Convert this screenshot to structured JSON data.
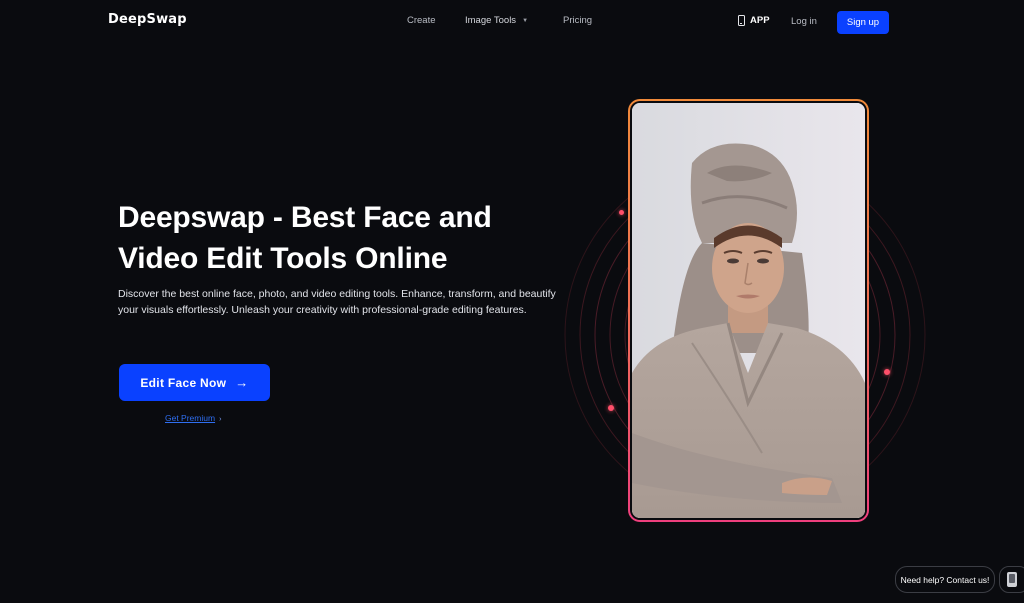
{
  "header": {
    "logo": "DeepSwap",
    "nav": {
      "create": "Create",
      "image_tools": "Image Tools",
      "pricing": "Pricing"
    },
    "app_label": "APP",
    "login_label": "Log in",
    "signup_label": "Sign up"
  },
  "hero": {
    "title": "Deepswap - Best Face and Video Edit Tools Online",
    "description": "Discover the best online face, photo, and video editing tools. Enhance, transform, and beautify your visuals effortlessly. Unleash your creativity with professional-grade editing features.",
    "cta_label": "Edit Face Now",
    "cta_arrow": "→",
    "premium_label": "Get Premium",
    "premium_chevron": "›"
  },
  "visual": {
    "image_alt": "Woman with towel wrapped on head wearing a bathrobe",
    "frame_gradient": [
      "#f18a3a",
      "#ef3f7d"
    ],
    "dot_color": "#ff4f6a"
  },
  "help": {
    "label": "Need help? Contact us!"
  },
  "colors": {
    "background": "#0a0b0f",
    "accent": "#0a41ff",
    "link": "#2f6ef0"
  }
}
